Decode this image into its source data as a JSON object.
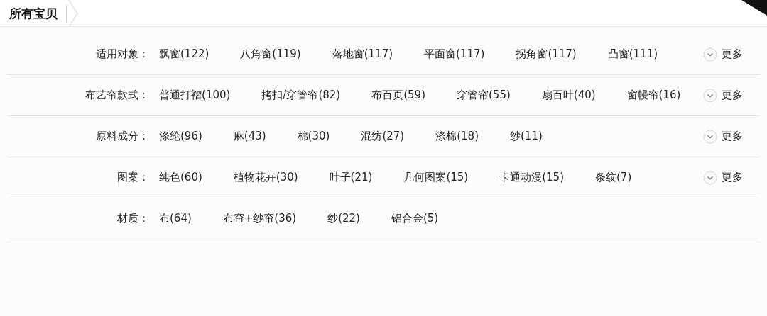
{
  "header": {
    "title": "所有宝贝"
  },
  "filters": [
    {
      "label": "适用对象：",
      "options": [
        "飘窗(122)",
        "八角窗(119)",
        "落地窗(117)",
        "平面窗(117)",
        "拐角窗(117)",
        "凸窗(111)"
      ],
      "more": "更多"
    },
    {
      "label": "布艺帘款式：",
      "options": [
        "普通打褶(100)",
        "拷扣/穿管帘(82)",
        "布百页(59)",
        "穿管帘(55)",
        "扇百叶(40)",
        "窗幔帘(16)"
      ],
      "more": "更多"
    },
    {
      "label": "原料成分：",
      "options": [
        "涤纶(96)",
        "麻(43)",
        "棉(30)",
        "混纺(27)",
        "涤棉(18)",
        "纱(11)"
      ],
      "more": "更多"
    },
    {
      "label": "图案：",
      "options": [
        "纯色(60)",
        "植物花卉(30)",
        "叶子(21)",
        "几何图案(15)",
        "卡通动漫(15)",
        "条纹(7)"
      ],
      "more": "更多"
    },
    {
      "label": "材质：",
      "options": [
        "布(64)",
        "布帘+纱帘(36)",
        "纱(22)",
        "铝合金(5)"
      ]
    }
  ]
}
